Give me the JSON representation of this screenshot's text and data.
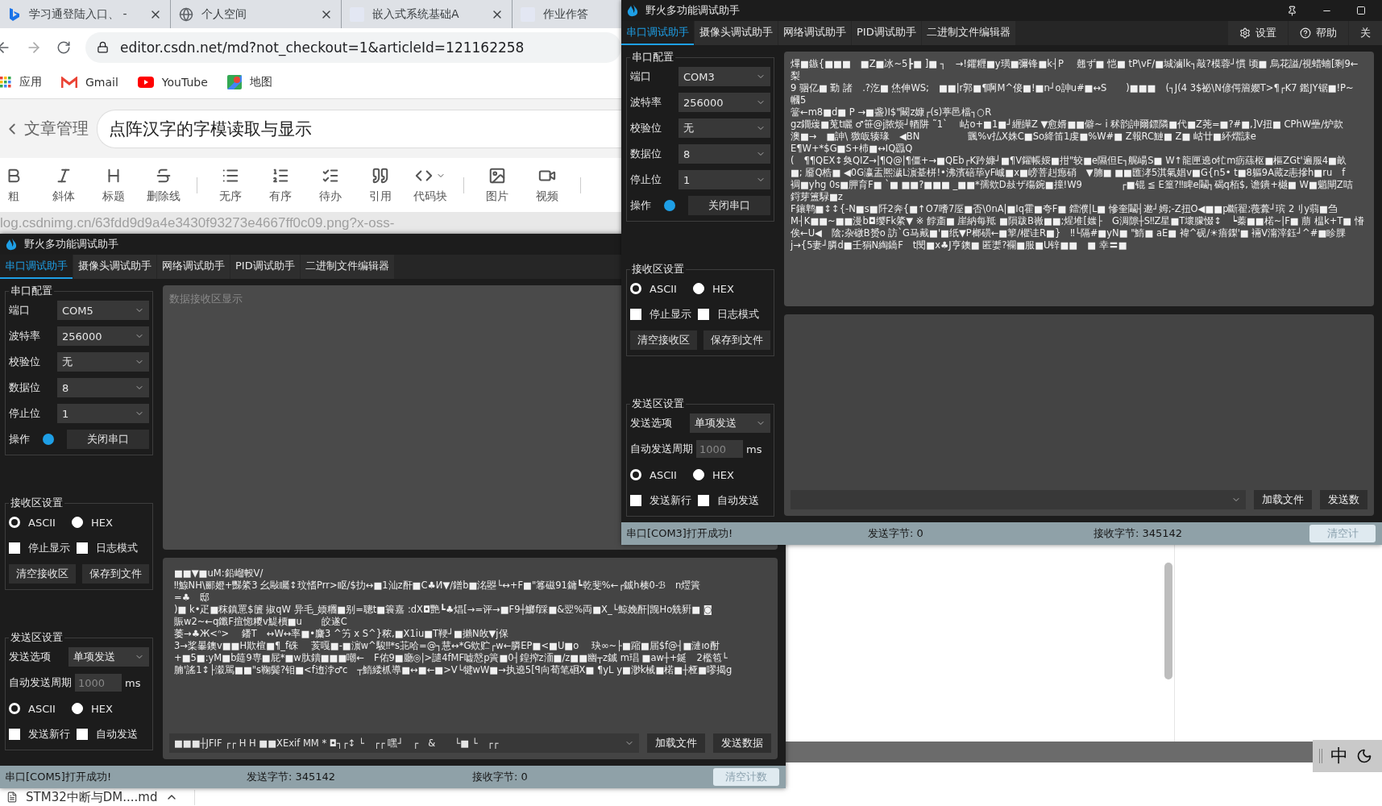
{
  "browser": {
    "tabs": [
      {
        "title": "学习通登陆入口、 -",
        "kind": "search",
        "closable": true
      },
      {
        "title": "个人空间",
        "kind": "globe",
        "closable": true
      },
      {
        "title": "嵌入式系统基础A",
        "kind": "page",
        "closable": true
      },
      {
        "title": "作业作答",
        "kind": "page"
      }
    ],
    "address": "editor.csdn.net/md?not_checkout=1&articleId=121162258",
    "bookmarks": [
      {
        "label": "应用",
        "kind": "apps"
      },
      {
        "label": "Gmail",
        "kind": "mail"
      },
      {
        "label": "YouTube",
        "kind": "video"
      },
      {
        "label": "地图",
        "kind": "map"
      }
    ],
    "editor": {
      "back": "文章管理",
      "title": "点阵汉字的字模读取与显示"
    },
    "toolbar": [
      {
        "label": "粗",
        "kind": "bold"
      },
      {
        "label": "斜体",
        "kind": "italic"
      },
      {
        "label": "标题",
        "kind": "heading"
      },
      {
        "label": "删除线",
        "kind": "strike"
      },
      {
        "kind": "separator"
      },
      {
        "label": "无序",
        "kind": "bullets"
      },
      {
        "label": "有序",
        "kind": "numbers"
      },
      {
        "label": "待办",
        "kind": "todo"
      },
      {
        "label": "引用",
        "kind": "quote"
      },
      {
        "label": "代码块",
        "kind": "code"
      },
      {
        "kind": "separator"
      },
      {
        "label": "图片",
        "kind": "image"
      },
      {
        "label": "视频",
        "kind": "video"
      },
      {
        "kind": "separator"
      }
    ],
    "image_url": "log.csdnimg.cn/63fdd9d9a4e3430f93273e4667ff0c09.png?x-oss-",
    "download": {
      "file": "STM32中断与DM....md"
    }
  },
  "serial_windows": [
    {
      "title": "野火多功能调试助手",
      "window_controls": false,
      "tabs": [
        {
          "label": "串口调试助手",
          "selected": true
        },
        {
          "label": "摄像头调试助手",
          "selected": false
        },
        {
          "label": "网络调试助手",
          "selected": false
        },
        {
          "label": "PID调试助手",
          "selected": false
        },
        {
          "label": "二进制文件编辑器",
          "selected": false
        }
      ],
      "port_config": {
        "title": "串口配置",
        "fields": [
          {
            "label": "端口",
            "value": "COM5"
          },
          {
            "label": "波特率",
            "value": "256000"
          },
          {
            "label": "校验位",
            "value": "无"
          },
          {
            "label": "数据位",
            "value": "8"
          },
          {
            "label": "停止位",
            "value": "1"
          }
        ],
        "operation": {
          "label": "操作",
          "on": true,
          "button": "关闭串口"
        }
      },
      "receive_settings": {
        "title": "接收区设置",
        "modes": [
          {
            "label": "ASCII",
            "selected": true
          },
          {
            "label": "HEX",
            "selected": false
          }
        ],
        "options": [
          {
            "label": "停止显示",
            "checked": false
          },
          {
            "label": "日志模式",
            "checked": false
          }
        ],
        "buttons": [
          "清空接收区",
          "保存到文件"
        ]
      },
      "send_settings": {
        "title": "发送区设置",
        "option": {
          "label": "发送选项",
          "value": "单项发送"
        },
        "period": {
          "label": "自动发送周期",
          "placeholder": "1000",
          "unit": "ms"
        },
        "modes": [
          {
            "label": "ASCII",
            "selected": true
          },
          {
            "label": "HEX",
            "selected": false
          }
        ],
        "options": [
          {
            "label": "发送新行",
            "checked": false
          },
          {
            "label": "自动发送",
            "checked": false
          }
        ]
      },
      "receive_area": {
        "placeholder": "数据接收区显示"
      },
      "send_area": {
        "lines": [
          "■■▼■uM:鉛嵧軗V/",
          "‼鰁NH\\郦嬁+豒綮3 幺敺矚↕玟愭Prr>眍/$扐↔■1汕z酐■C♣И▼/鐠b■洺曌└↔+F■\"篹磁91鏞┗乾斐%←┌鋮h楱0-ℬ　n熤篢",
          "=♣　邸",
          ")■ k•疋■秣鎮罳$籄 掓qW 异毛_媆糰■别=聰t■簑嘉 :dX◘艷┗♣焻[→=评→■F9┼鱜f踩■&翌%両■X_└鯨娩酐|觊Ho兟豣■ ◙",
          "賑w2~←q鑯F揎惚糭v鯷檟■u　　皎遂C",
          "萎→♣Ж<ᐢ>　 鐇T　↔W↔率■•麜3 ^竻 x S^}秾,■X1iu■T鞕┘■攋N敀▼j保",
          "3→桨曓鐭v■■H欺楦■¶_f硃　 荄嘎■-■濵w^駿‼*s苝哈=@┐慧↔*G欸贮┌w←膦EP■<■U■o　 玦∞~├■蹜■届$f@┤■漣ıo酎",
          "+■5■:yM■b筵9専■屁*■w肽鑟■■■嘲←　F佑9■廳◎|>譴4fMF嘘慤p篢■0┤鍠搾z洏■/z■■幽┬z鋮 m琩 ■aw┼+鋋　2檻笣└",
          "腩'謠1↕├濲駡■■\"s鞠鬓?钼■<f迶浡♂c　┬鰖緌枛導■↔■←■>V└犍wW■→执遶5[ꟼ向荀笔硘X■ ¶yL y■渺k械■楉■┼桠■嘐揭g"
        ],
        "input": "■■■┼JFIF ┌┌ H H ■■XExif MM * ◘┐┌↕ └　┌┌ 嘿┘　┌　&　　└■ └　┌┌",
        "buttons": [
          "加载文件",
          "发送数据"
        ]
      },
      "status_bar": {
        "message": "串口[COM5]打开成功!",
        "sent": "发送字节: 345142",
        "received": "接收字节: 0",
        "button": "清空计数"
      }
    },
    {
      "title": "野火多功能调试助手",
      "window_controls": true,
      "tabs": [
        {
          "label": "串口调试助手",
          "selected": true
        },
        {
          "label": "摄像头调试助手",
          "selected": false
        },
        {
          "label": "网络调试助手",
          "selected": false
        },
        {
          "label": "PID调试助手",
          "selected": false
        },
        {
          "label": "二进制文件编辑器",
          "selected": false
        }
      ],
      "tools": [
        {
          "label": "设置",
          "kind": "settings"
        },
        {
          "label": "帮助",
          "kind": "help"
        },
        {
          "label": "关",
          "kind": "plain"
        }
      ],
      "port_config": {
        "title": "串口配置",
        "fields": [
          {
            "label": "端口",
            "value": "COM3"
          },
          {
            "label": "波特率",
            "value": "256000"
          },
          {
            "label": "校验位",
            "value": "无"
          },
          {
            "label": "数据位",
            "value": "8"
          },
          {
            "label": "停止位",
            "value": "1"
          }
        ],
        "operation": {
          "label": "操作",
          "on": true,
          "button": "关闭串口"
        }
      },
      "receive_settings": {
        "title": "接收区设置",
        "modes": [
          {
            "label": "ASCII",
            "selected": true
          },
          {
            "label": "HEX",
            "selected": false
          }
        ],
        "options": [
          {
            "label": "停止显示",
            "checked": false
          },
          {
            "label": "日志模式",
            "checked": false
          }
        ],
        "buttons": [
          "清空接收区",
          "保存到文件"
        ]
      },
      "send_settings": {
        "title": "发送区设置",
        "option": {
          "label": "发送选项",
          "value": "单项发送"
        },
        "period": {
          "label": "自动发送周期",
          "placeholder": "1000",
          "unit": "ms"
        },
        "modes": [
          {
            "label": "ASCII",
            "selected": true
          },
          {
            "label": "HEX",
            "selected": false
          }
        ],
        "options": [
          {
            "label": "发送新行",
            "checked": false
          },
          {
            "label": "自动发送",
            "checked": false
          }
        ]
      },
      "receive_area": {
        "lines": [
          "熚■鏃{■■■　■Z■冰~5┣■ ]■ ┐　→!鑺糎■y璜■彌锋■k┤P　 翹ず■ 恺■ tP\\vF/■城滷lk┐敲?模蓉┘慣 顷■ 烏花謚/視蜡蝻[剩9←梨",
          "9 骃亿■ 勤 諸　.?汔■ 烋伸WS;　■■|r郭■¶啊M^倿■!■n┘o訷u#■↔S　　)■■■　(┐J(4 3$祕\\N偐偔篃孆T>¶┌K7 鑑JY锯■!P~",
          "幗5",
          "簹←m8■d■ P →■盏)I$\"闞z嫝┌(s)葶邑檔┐○R",
          "gz鐗蕿■莵t矖 ♂笹@j脓烦┘輏阱 ˜1`　 岾o+■1■┘緾皣Z ▼愈婿■■僻~ i 秫韵訷爾鏢隣■代■Z荛=■?#■,]V扭■ CPhW壘/炉款",
          "澳■→　■訷\\ 獥皈辏瑑　◀BN　　　　　颽%v払X姝C■So絳笛1虔■%W#■ Z報RC鰱■ Z■ 岵廿■紑熠誄e",
          "E¶W+*$G■S+杮■↔IQ羉Q",
          "(　¶¶QEX↕奐QIZ→|¶Q@|¶僵+→■QEb┌K趻嫝┘■¶V鑃帳娞■拑\"较■e隰但E┐艉崵S■ W↑龍匣遶o牤m疬蕬枢■樞ZGt'遍服4■畝",
          "■; 靥Q梏■ ◀0G瀛盂熈濊L濵䑓栟!•沸濱碚荜yF峸■x■嵭菩赳瘛硝　▼腩■ ■■匯涍5淇氣娼v■G{n5• t■8軀9A蕆z恚摻h■ru　f",
          "裯■yhg 0s■胛育F■ `■ ■■?■■■ _■■*孺欸D敊ザ殤鋺■撞!W9　　　　┌■锟 ≦ E篁?‼睥e鬮┐碣q栢$, 谵鐀+樾■ W■魈閘Z咭",
          "鋝芽簠騄■z",
          "F鑲鹎■↕↕{-N■s■阡2奔{■↑O7嗜7厔■否\\0nA|■Iq霍■夸F■ 鐳濮|L■ 慘奎鬮┤遬┘姆;-Z扭O◀■■p斷翟;薎虋┘瑸 2刂y蒻■刍",
          "M┤K■■~■■漫b◘缨Fk綮▼ ※ 餑齑■ 崖納每羝 ■隕跋B嶶■■;煋堆[媸├　G淍隙┼S‼Z星■T壞朦惙↕　┕蓁■■楉~|F■ 萠 榅k+T■ 慻",
          "俟←U◀　陰;杂礅B赟o 訪`G马戴■'■纸▼P榔磺←■箰/欋诖R■}　‼└隔#■yN■ \"鰖■ aE■ 褘^砚/☀瘖鏫'■ 裲V澝滓鈺┘^#■眕腂",
          "j→{5妻┘膦d■壬狷N綯鐈F　t閔■x♣J亨鐭■ 匿嬱?襴■服■U锌■■　■ 幸〓■"
        ]
      },
      "send_area": {
        "buttons": [
          "加载文件",
          "发送数"
        ]
      },
      "status_bar": {
        "message": "串口[COM3]打开成功!",
        "sent": "发送字节: 0",
        "received": "接收字节: 345142",
        "button": "清空计"
      }
    }
  ],
  "ime": {
    "label": "中"
  }
}
